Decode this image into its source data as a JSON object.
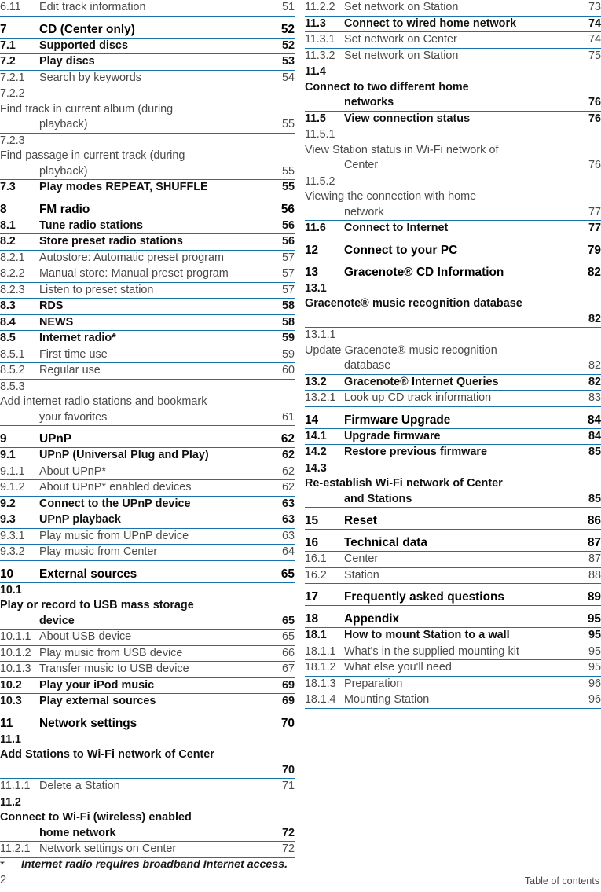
{
  "document": {
    "footer_label": "Table of contents",
    "page_number": "2",
    "footnote_marker": "*",
    "footnote_text": "Internet radio requires broadband Internet access.",
    "rule_color": "#1a72ab"
  },
  "left_column": [
    {
      "num": "6.11",
      "title": "Edit track information",
      "page": "51",
      "level": "sub",
      "gap": false
    },
    {
      "num": "7",
      "title": "CD (Center  only)",
      "page": "52",
      "level": "chap",
      "gap": true
    },
    {
      "num": "7.1",
      "title": "Supported discs",
      "page": "52",
      "level": "sec",
      "gap": false
    },
    {
      "num": "7.2",
      "title": "Play discs",
      "page": "53",
      "level": "sec",
      "gap": false
    },
    {
      "num": "7.2.1",
      "title": "Search by keywords",
      "page": "54",
      "level": "sub",
      "gap": false
    },
    {
      "num": "7.2.2",
      "title": "Find track in current album (during",
      "title2": "playback)",
      "page": "55",
      "level": "sub",
      "gap": false
    },
    {
      "num": "7.2.3",
      "title": "Find passage in current track (during",
      "title2": "playback)",
      "page": "55",
      "level": "sub",
      "gap": false
    },
    {
      "num": "7.3",
      "title": "Play modes REPEAT, SHUFFLE",
      "page": "55",
      "level": "sec",
      "gap": false
    },
    {
      "num": "8",
      "title": "FM radio",
      "page": "56",
      "level": "chap",
      "gap": true
    },
    {
      "num": "8.1",
      "title": "Tune radio stations",
      "page": "56",
      "level": "sec",
      "gap": false
    },
    {
      "num": "8.2",
      "title": "Store preset radio stations",
      "page": "56",
      "level": "sec",
      "gap": false
    },
    {
      "num": "8.2.1",
      "title": "Autostore:  Automatic preset program",
      "page": "57",
      "level": "sub",
      "gap": false
    },
    {
      "num": "8.2.2",
      "title": "Manual store: Manual preset program",
      "page": "57",
      "level": "sub",
      "gap": false
    },
    {
      "num": "8.2.3",
      "title": "Listen to preset station",
      "page": "57",
      "level": "sub",
      "gap": false
    },
    {
      "num": "8.3",
      "title": "RDS",
      "page": "58",
      "level": "sec",
      "gap": false
    },
    {
      "num": "8.4",
      "title": "NEWS",
      "page": "58",
      "level": "sec",
      "gap": false
    },
    {
      "num": "8.5",
      "title": "Internet radio*",
      "page": "59",
      "level": "sec",
      "gap": false
    },
    {
      "num": "8.5.1",
      "title": "First time use",
      "page": "59",
      "level": "sub",
      "gap": false
    },
    {
      "num": "8.5.2",
      "title": "Regular use",
      "page": "60",
      "level": "sub",
      "gap": false
    },
    {
      "num": "8.5.3",
      "title": "Add internet radio stations and bookmark",
      "title2": "your favorites",
      "page": "61",
      "level": "sub",
      "gap": false
    },
    {
      "num": "9",
      "title": "UPnP",
      "page": "62",
      "level": "chap",
      "gap": true
    },
    {
      "num": "9.1",
      "title": "UPnP (Universal Plug and Play)",
      "page": "62",
      "level": "sec",
      "gap": false
    },
    {
      "num": "9.1.1",
      "title": "About UPnP*",
      "page": "62",
      "level": "sub",
      "gap": false
    },
    {
      "num": "9.1.2",
      "title": "About UPnP* enabled devices",
      "page": "62",
      "level": "sub",
      "gap": false
    },
    {
      "num": "9.2",
      "title": "Connect to the UPnP device",
      "page": "63",
      "level": "sec",
      "gap": false
    },
    {
      "num": "9.3",
      "title": "UPnP playback",
      "page": "63",
      "level": "sec",
      "gap": false
    },
    {
      "num": "9.3.1",
      "title": "Play music from UPnP device",
      "page": "63",
      "level": "sub",
      "gap": false
    },
    {
      "num": "9.3.2",
      "title": "Play music from Center",
      "page": "64",
      "level": "sub",
      "gap": false
    },
    {
      "num": "10",
      "title": "External sources",
      "page": "65",
      "level": "chap",
      "gap": true
    },
    {
      "num": "10.1",
      "title": "Play or record to USB mass storage",
      "title2": "device",
      "page": "65",
      "level": "sec",
      "gap": false
    },
    {
      "num": "10.1.1",
      "title": "About USB device",
      "page": "65",
      "level": "sub",
      "gap": false
    },
    {
      "num": "10.1.2",
      "title": "Play music from USB device",
      "page": "66",
      "level": "sub",
      "gap": false
    },
    {
      "num": "10.1.3",
      "title": "Transfer music to USB device",
      "page": "67",
      "level": "sub",
      "gap": false
    },
    {
      "num": "10.2",
      "title": "Play your iPod music",
      "page": "69",
      "level": "sec",
      "gap": false
    },
    {
      "num": "10.3",
      "title": "Play external sources",
      "page": "69",
      "level": "sec",
      "gap": false
    },
    {
      "num": "11",
      "title": "Network settings",
      "page": "70",
      "level": "chap",
      "gap": true
    },
    {
      "num": "11.1",
      "title": "Add Stations to Wi-Fi network of Center",
      "title2": "",
      "page": "70",
      "level": "sec",
      "gap": false
    },
    {
      "num": "11.1.1",
      "title": "Delete a Station",
      "page": "71",
      "level": "sub",
      "gap": false
    },
    {
      "num": "11.2",
      "title": "Connect to Wi-Fi (wireless) enabled",
      "title2": "home network",
      "page": "72",
      "level": "sec",
      "gap": false
    },
    {
      "num": "11.2.1",
      "title": "Network settings on Center",
      "page": "72",
      "level": "sub",
      "gap": false
    }
  ],
  "right_column": [
    {
      "num": "11.2.2",
      "title": "Set network on Station",
      "page": "73",
      "level": "sub",
      "gap": false
    },
    {
      "num": "11.3",
      "title": "Connect to wired home network",
      "page": "74",
      "level": "sec",
      "gap": false
    },
    {
      "num": "11.3.1",
      "title": "Set network on Center",
      "page": "74",
      "level": "sub",
      "gap": false
    },
    {
      "num": "11.3.2",
      "title": "Set network on Station",
      "page": "75",
      "level": "sub",
      "gap": false
    },
    {
      "num": "11.4",
      "title": "Connect to two different home",
      "title2": "networks",
      "page": "76",
      "level": "sec",
      "gap": false
    },
    {
      "num": "11.5",
      "title": "View connection status",
      "page": "76",
      "level": "sec",
      "gap": false
    },
    {
      "num": "11.5.1",
      "title": "View Station status in Wi-Fi network of",
      "title2": "Center",
      "page": "76",
      "level": "sub",
      "gap": false
    },
    {
      "num": "11.5.2",
      "title": "Viewing the connection with home",
      "title2": "network",
      "page": "77",
      "level": "sub",
      "gap": false
    },
    {
      "num": "11.6",
      "title": "Connect to Internet",
      "page": "77",
      "level": "sec",
      "gap": false
    },
    {
      "num": "12",
      "title": "Connect to your PC",
      "page": "79",
      "level": "chap",
      "gap": true
    },
    {
      "num": "13",
      "title": "Gracenote® CD Information",
      "page": "82",
      "level": "chap",
      "gap": true
    },
    {
      "num": "13.1",
      "title": "Gracenote® music recognition database",
      "title2": "",
      "page": "82",
      "level": "sec",
      "gap": false
    },
    {
      "num": "13.1.1",
      "title": "Update Gracenote® music recognition",
      "title2": "database",
      "page": "82",
      "level": "sub",
      "gap": false
    },
    {
      "num": "13.2",
      "title": "Gracenote® Internet Queries",
      "page": "82",
      "level": "sec",
      "gap": false
    },
    {
      "num": "13.2.1",
      "title": "Look up CD track information",
      "page": "83",
      "level": "sub",
      "gap": false
    },
    {
      "num": "14",
      "title": "Firmware Upgrade",
      "page": "84",
      "level": "chap",
      "gap": true
    },
    {
      "num": "14.1",
      "title": "Upgrade firmware",
      "page": "84",
      "level": "sec",
      "gap": false
    },
    {
      "num": "14.2",
      "title": "Restore previous firmware",
      "page": "85",
      "level": "sec",
      "gap": false
    },
    {
      "num": "14.3",
      "title": "Re-establish Wi-Fi network of Center",
      "title2": "and Stations",
      "page": "85",
      "level": "sec",
      "gap": false
    },
    {
      "num": "15",
      "title": "Reset",
      "page": "86",
      "level": "chap",
      "gap": true
    },
    {
      "num": "16",
      "title": "Technical data",
      "page": "87",
      "level": "chap",
      "gap": true
    },
    {
      "num": "16.1",
      "title": "Center",
      "page": "87",
      "level": "sub",
      "gap": false
    },
    {
      "num": "16.2",
      "title": "Station",
      "page": "88",
      "level": "sub",
      "gap": false
    },
    {
      "num": "17",
      "title": "Frequently asked questions",
      "page": "89",
      "level": "chap",
      "gap": true
    },
    {
      "num": "18",
      "title": "Appendix",
      "page": "95",
      "level": "chap",
      "gap": true
    },
    {
      "num": "18.1",
      "title": "How to mount Station to a wall",
      "page": "95",
      "level": "sec",
      "gap": false
    },
    {
      "num": "18.1.1",
      "title": "What's in the supplied mounting kit",
      "page": "95",
      "level": "sub",
      "gap": false
    },
    {
      "num": "18.1.2",
      "title": "What else you'll need",
      "page": "95",
      "level": "sub",
      "gap": false
    },
    {
      "num": "18.1.3",
      "title": "Preparation",
      "page": "96",
      "level": "sub",
      "gap": false
    },
    {
      "num": "18.1.4",
      "title": "Mounting Station",
      "page": "96",
      "level": "sub",
      "gap": false
    }
  ]
}
